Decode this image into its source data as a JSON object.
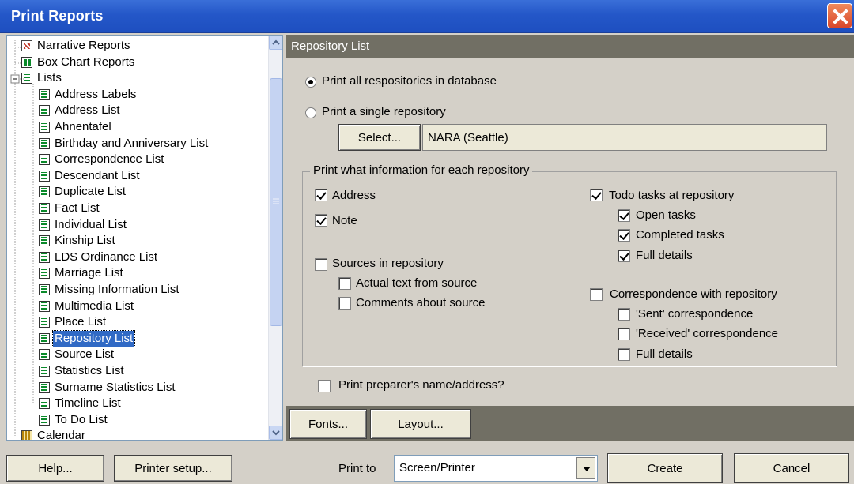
{
  "window": {
    "title": "Print Reports"
  },
  "tree": {
    "items": [
      {
        "label": "Narrative Reports",
        "icon": "narrative-icon",
        "level": 1
      },
      {
        "label": "Box Chart Reports",
        "icon": "box-chart-icon",
        "level": 1
      },
      {
        "label": "Lists",
        "icon": "list-icon",
        "level": 1
      },
      {
        "label": "Address Labels",
        "icon": "list-icon",
        "level": 2
      },
      {
        "label": "Address List",
        "icon": "list-icon",
        "level": 2
      },
      {
        "label": "Ahnentafel",
        "icon": "list-icon",
        "level": 2
      },
      {
        "label": "Birthday and Anniversary List",
        "icon": "list-icon",
        "level": 2
      },
      {
        "label": "Correspondence List",
        "icon": "list-icon",
        "level": 2
      },
      {
        "label": "Descendant List",
        "icon": "list-icon",
        "level": 2
      },
      {
        "label": "Duplicate List",
        "icon": "list-icon",
        "level": 2
      },
      {
        "label": "Fact List",
        "icon": "list-icon",
        "level": 2
      },
      {
        "label": "Individual List",
        "icon": "list-icon",
        "level": 2
      },
      {
        "label": "Kinship List",
        "icon": "list-icon",
        "level": 2
      },
      {
        "label": "LDS Ordinance List",
        "icon": "list-icon",
        "level": 2
      },
      {
        "label": "Marriage List",
        "icon": "list-icon",
        "level": 2
      },
      {
        "label": "Missing Information List",
        "icon": "list-icon",
        "level": 2
      },
      {
        "label": "Multimedia List",
        "icon": "list-icon",
        "level": 2
      },
      {
        "label": "Place List",
        "icon": "list-icon",
        "level": 2
      },
      {
        "label": "Repository List",
        "icon": "list-icon",
        "level": 2,
        "selected": true
      },
      {
        "label": "Source List",
        "icon": "list-icon",
        "level": 2
      },
      {
        "label": "Statistics List",
        "icon": "list-icon",
        "level": 2
      },
      {
        "label": "Surname Statistics List",
        "icon": "list-icon",
        "level": 2
      },
      {
        "label": "Timeline List",
        "icon": "list-icon",
        "level": 2
      },
      {
        "label": "To Do List",
        "icon": "list-icon",
        "level": 2
      },
      {
        "label": "Calendar",
        "icon": "calendar-icon",
        "level": 1
      }
    ]
  },
  "panel": {
    "header": "Repository List",
    "print_all": {
      "label": "Print all respositories in database",
      "selected": true
    },
    "print_single": {
      "label": "Print a single repository",
      "selected": false
    },
    "select_button": "Select...",
    "repository_value": "NARA (Seattle)",
    "group_title": "Print what information for each repository",
    "options": {
      "address": {
        "label": "Address",
        "checked": true
      },
      "note": {
        "label": "Note",
        "checked": true
      },
      "sources": {
        "label": "Sources in repository",
        "checked": false
      },
      "actual_text": {
        "label": "Actual text from source",
        "checked": false
      },
      "comments": {
        "label": "Comments about source",
        "checked": false
      },
      "todo": {
        "label": "Todo tasks at repository",
        "checked": true
      },
      "open_tasks": {
        "label": "Open tasks",
        "checked": true
      },
      "completed_tasks": {
        "label": "Completed tasks",
        "checked": true
      },
      "full_details_todo": {
        "label": "Full details",
        "checked": true
      },
      "correspondence": {
        "label": "Correspondence with repository",
        "checked": false
      },
      "sent": {
        "label": "'Sent' correspondence",
        "checked": false
      },
      "received": {
        "label": "'Received' correspondence",
        "checked": false
      },
      "full_details_corr": {
        "label": "Full details",
        "checked": false
      }
    },
    "preparer": {
      "label": "Print preparer's name/address?",
      "checked": false
    },
    "fonts_button": "Fonts...",
    "layout_button": "Layout..."
  },
  "footer": {
    "help_button": "Help...",
    "printer_setup_button": "Printer setup...",
    "print_to_label": "Print to",
    "print_to_value": "Screen/Printer",
    "create_button": "Create",
    "cancel_button": "Cancel"
  }
}
